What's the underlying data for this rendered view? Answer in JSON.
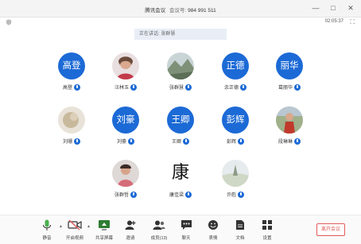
{
  "window": {
    "title": "腾讯会议",
    "meeting_id_label": "会议号:",
    "meeting_id": "984 991 511",
    "timer": "02:05:37"
  },
  "speaking": {
    "text": "正在讲话: 张群慧"
  },
  "participants": [
    {
      "name": "高登",
      "avatar_text": "高登",
      "avatar_type": "text"
    },
    {
      "name": "汪林玉",
      "avatar_text": "",
      "avatar_type": "photo"
    },
    {
      "name": "张群慧",
      "avatar_text": "",
      "avatar_type": "photo"
    },
    {
      "name": "余正德",
      "avatar_text": "正德",
      "avatar_type": "text"
    },
    {
      "name": "葛丽华",
      "avatar_text": "丽华",
      "avatar_type": "text"
    },
    {
      "name": "刘珊",
      "avatar_text": "",
      "avatar_type": "photo"
    },
    {
      "name": "刘豪",
      "avatar_text": "刘豪",
      "avatar_type": "text"
    },
    {
      "name": "王卿",
      "avatar_text": "王卿",
      "avatar_type": "text"
    },
    {
      "name": "彭辉",
      "avatar_text": "彭辉",
      "avatar_type": "text"
    },
    {
      "name": "段琳琳",
      "avatar_text": "",
      "avatar_type": "photo"
    },
    {
      "name": "张群哲",
      "avatar_text": "",
      "avatar_type": "photo"
    },
    {
      "name": "康佳梁",
      "avatar_text": "康",
      "avatar_type": "photo"
    },
    {
      "name": "许彪",
      "avatar_text": "",
      "avatar_type": "photo"
    }
  ],
  "toolbar": {
    "mute": "静音",
    "video": "开启视频",
    "share": "共享屏幕",
    "invite": "邀请",
    "members": "成员(13)",
    "chat": "聊天",
    "emoji": "表情",
    "docs": "文档",
    "settings": "设置",
    "leave": "离开会议"
  },
  "colors": {
    "accent": "#1c6ad6",
    "danger": "#e25b5b"
  }
}
